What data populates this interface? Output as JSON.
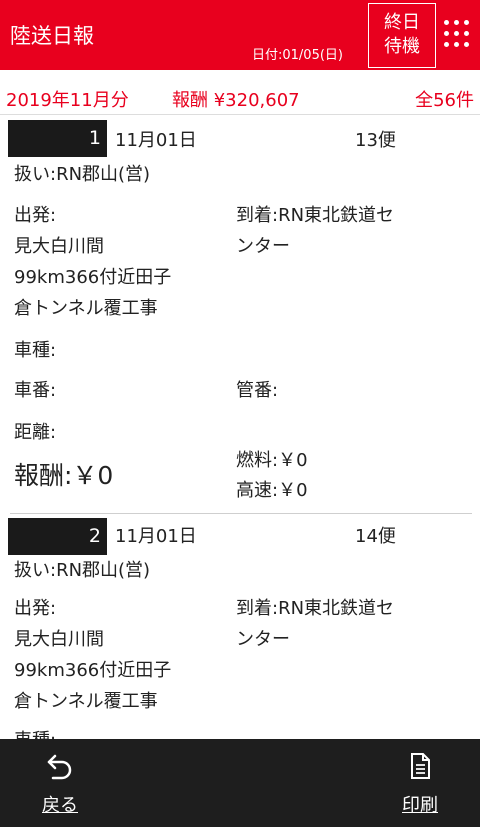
{
  "header": {
    "title": "陸送日報",
    "date_label": "日付:01/05(日)",
    "end_wait_line1": "終日",
    "end_wait_line2": "待機",
    "menu_icon": "grid-menu-icon"
  },
  "summary": {
    "month": "2019年11月分",
    "reward": "報酬 ¥320,607",
    "count": "全56件"
  },
  "records": [
    {
      "number": "1",
      "date": "11月01日",
      "bin": "13便",
      "handler": "扱い:RN郡山(営)",
      "departure_label": "出発:",
      "departure_line1": "見大白川間",
      "departure_line2": "99km366付近田子",
      "departure_line3": "倉トンネル覆工事",
      "arrival_line1": "到着:RN東北鉄道セ",
      "arrival_line2": "ンター",
      "vehicle_type": "車種:",
      "vehicle_number": "車番:",
      "management_number": "管番:",
      "distance": "距離:",
      "reward": "報酬:￥0",
      "fuel": "燃料:￥0",
      "highway": "高速:￥0"
    },
    {
      "number": "2",
      "date": "11月01日",
      "bin": "14便",
      "handler": "扱い:RN郡山(営)",
      "departure_label": "出発:",
      "departure_line1": "見大白川間",
      "departure_line2": "99km366付近田子",
      "departure_line3": "倉トンネル覆工事",
      "arrival_line1": "到着:RN東北鉄道セ",
      "arrival_line2": "ンター",
      "vehicle_type": "車種:"
    }
  ],
  "bottom_bar": {
    "back_label": "戻る",
    "back_icon": "back-arrow-icon",
    "print_label": "印刷",
    "print_icon": "document-icon"
  },
  "colors": {
    "brand_red": "#e8001e",
    "bottom_bar": "#1e1e1e",
    "number_badge": "#1a1a1a"
  }
}
